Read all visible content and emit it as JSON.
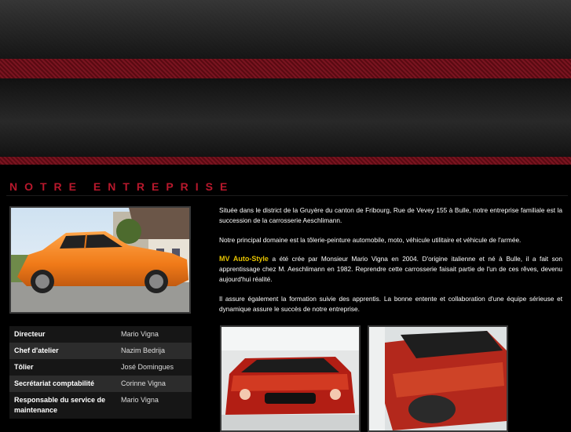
{
  "section": {
    "title": "NOTRE ENTREPRISE"
  },
  "staff": [
    {
      "role": "Directeur",
      "name": "Mario Vigna"
    },
    {
      "role": "Chef d'atelier",
      "name": "Nazim Bedrija"
    },
    {
      "role": "Tôlier",
      "name": "José Domingues"
    },
    {
      "role": "Secrétariat comptabilité",
      "name": "Corinne Vigna"
    },
    {
      "role": "Responsable du service de maintenance",
      "name": "Mario Vigna"
    }
  ],
  "intro": {
    "p1": "Située dans le district de la Gruyère du canton de Fribourg, Rue de Vevey 155 à Bulle, notre entreprise familiale est la succession de la carrosserie Aeschlimann.",
    "p2": "Notre principal domaine est la tôlerie-peinture automobile, moto, véhicule utilitaire et véhicule de l'armée.",
    "brand": "MV Auto-Style",
    "p3_rest": " a été crée par Monsieur Mario Vigna en 2004. D'origine italienne et né à Bulle, il a fait son apprentissage chez M. Aeschlimann en 1982. Reprendre cette carrosserie faisait partie de l'un de ces rêves, devenu aujourd'hui réalité.",
    "p4": "Il assure également la formation suivie des apprentis. La bonne entente et collaboration d'une équipe sérieuse et dynamique assure le succès de notre entreprise."
  },
  "colors": {
    "accent": "#b8182c",
    "brand": "#e6c300"
  }
}
